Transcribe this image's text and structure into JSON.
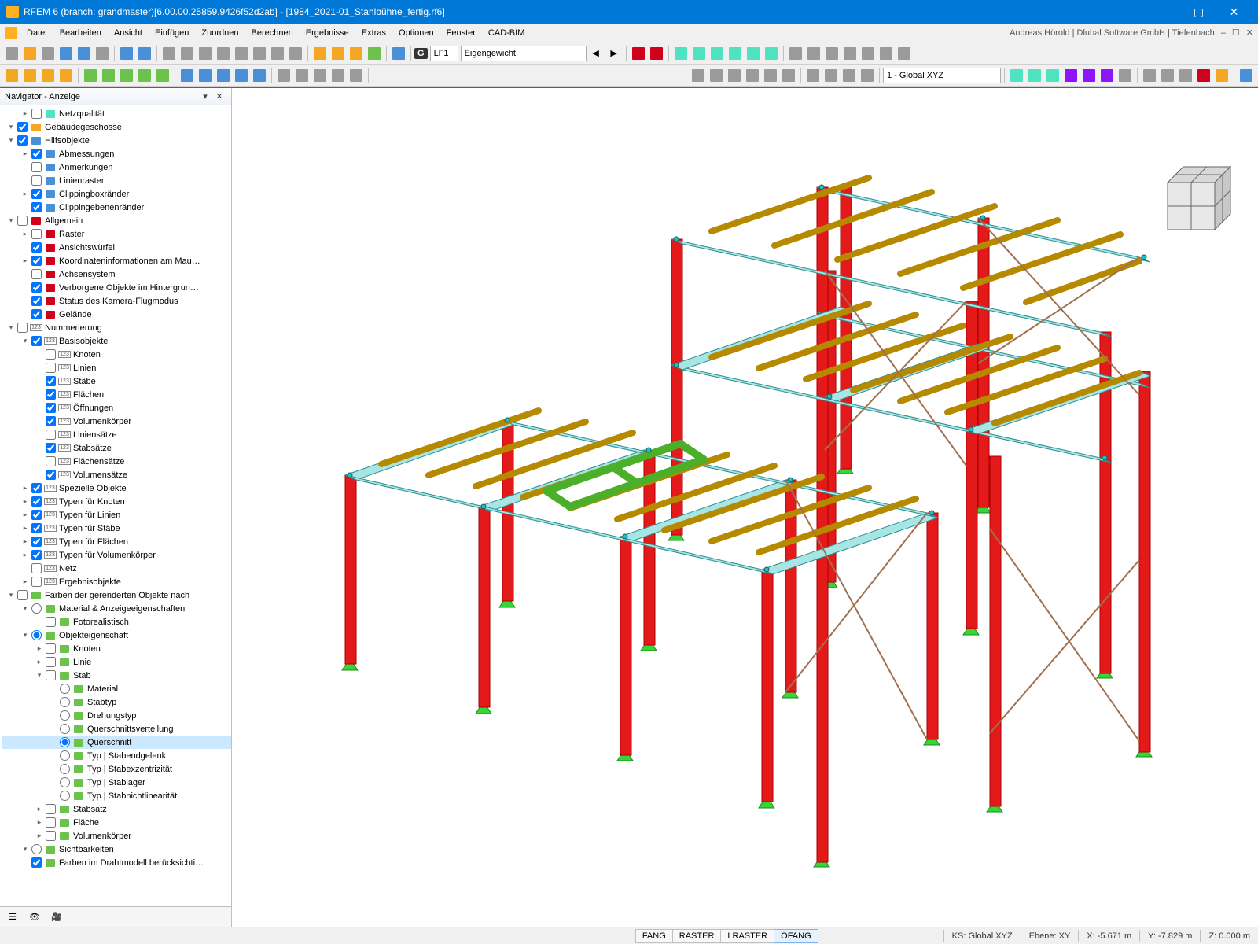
{
  "title": "RFEM 6 (branch: grandmaster)[6.00.00.25859.9426f52d2ab] - [1984_2021-01_Stahlbühne_fertig.rf6]",
  "menu": [
    "Datei",
    "Bearbeiten",
    "Ansicht",
    "Einfügen",
    "Zuordnen",
    "Berechnen",
    "Ergebnisse",
    "Extras",
    "Optionen",
    "Fenster",
    "CAD-BIM"
  ],
  "userline": "Andreas Hörold | Dlubal Software GmbH | Tiefenbach",
  "tb1": {
    "lf_badge": "G",
    "lf": "LF1",
    "lf_name": "Eigengewicht"
  },
  "tb2": {
    "coord": "1 - Global XYZ"
  },
  "nav": {
    "title": "Navigator - Anzeige"
  },
  "tree": [
    {
      "d": 1,
      "e": ">",
      "c": false,
      "ic": "i-cyan",
      "t": "Netzqualität"
    },
    {
      "d": 0,
      "e": "v",
      "c": true,
      "ic": "i-orange",
      "t": "Gebäudegeschosse"
    },
    {
      "d": 0,
      "e": "v",
      "c": true,
      "ic": "i-blue",
      "t": "Hilfsobjekte"
    },
    {
      "d": 1,
      "e": ">",
      "c": true,
      "ic": "i-blue",
      "t": "Abmessungen"
    },
    {
      "d": 1,
      "e": "",
      "c": false,
      "ic": "i-blue",
      "t": "Anmerkungen"
    },
    {
      "d": 1,
      "e": "",
      "c": false,
      "ic": "i-blue",
      "t": "Linienraster"
    },
    {
      "d": 1,
      "e": ">",
      "c": true,
      "ic": "i-blue",
      "t": "Clippingboxränder"
    },
    {
      "d": 1,
      "e": "",
      "c": true,
      "ic": "i-blue",
      "t": "Clippingebenenränder"
    },
    {
      "d": 0,
      "e": "v",
      "c": false,
      "ic": "i-red",
      "t": "Allgemein"
    },
    {
      "d": 1,
      "e": ">",
      "c": false,
      "ic": "i-red",
      "t": "Raster"
    },
    {
      "d": 1,
      "e": "",
      "c": true,
      "ic": "i-red",
      "t": "Ansichtswürfel"
    },
    {
      "d": 1,
      "e": ">",
      "c": true,
      "ic": "i-red",
      "t": "Koordinateninformationen am Mau…"
    },
    {
      "d": 1,
      "e": "",
      "c": false,
      "ic": "i-red",
      "t": "Achsensystem"
    },
    {
      "d": 1,
      "e": "",
      "c": true,
      "ic": "i-red",
      "t": "Verborgene Objekte im Hintergrun…"
    },
    {
      "d": 1,
      "e": "",
      "c": true,
      "ic": "i-red",
      "t": "Status des Kamera-Flugmodus"
    },
    {
      "d": 1,
      "e": "",
      "c": true,
      "ic": "i-red",
      "t": "Gelände"
    },
    {
      "d": 0,
      "e": "v",
      "c": false,
      "ic": "i-gray",
      "t": "Nummerierung",
      "badge": "123"
    },
    {
      "d": 1,
      "e": "v",
      "c": true,
      "ic": "i-gray",
      "t": "Basisobjekte",
      "badge": "123"
    },
    {
      "d": 2,
      "e": "",
      "c": false,
      "ic": "i-gray",
      "t": "Knoten",
      "badge": "123"
    },
    {
      "d": 2,
      "e": "",
      "c": false,
      "ic": "i-gray",
      "t": "Linien",
      "badge": "123"
    },
    {
      "d": 2,
      "e": "",
      "c": true,
      "ic": "i-gray",
      "t": "Stäbe",
      "badge": "123"
    },
    {
      "d": 2,
      "e": "",
      "c": true,
      "ic": "i-gray",
      "t": "Flächen",
      "badge": "123"
    },
    {
      "d": 2,
      "e": "",
      "c": true,
      "ic": "i-gray",
      "t": "Öffnungen",
      "badge": "123"
    },
    {
      "d": 2,
      "e": "",
      "c": true,
      "ic": "i-gray",
      "t": "Volumenkörper",
      "badge": "123"
    },
    {
      "d": 2,
      "e": "",
      "c": false,
      "ic": "i-gray",
      "t": "Liniensätze",
      "badge": "123"
    },
    {
      "d": 2,
      "e": "",
      "c": true,
      "ic": "i-gray",
      "t": "Stabsätze",
      "badge": "123"
    },
    {
      "d": 2,
      "e": "",
      "c": false,
      "ic": "i-gray",
      "t": "Flächensätze",
      "badge": "123"
    },
    {
      "d": 2,
      "e": "",
      "c": true,
      "ic": "i-gray",
      "t": "Volumensätze",
      "badge": "123"
    },
    {
      "d": 1,
      "e": ">",
      "c": true,
      "ic": "i-gray",
      "t": "Spezielle Objekte",
      "badge": "123"
    },
    {
      "d": 1,
      "e": ">",
      "c": true,
      "ic": "i-gray",
      "t": "Typen für Knoten",
      "badge": "123"
    },
    {
      "d": 1,
      "e": ">",
      "c": true,
      "ic": "i-gray",
      "t": "Typen für Linien",
      "badge": "123"
    },
    {
      "d": 1,
      "e": ">",
      "c": true,
      "ic": "i-gray",
      "t": "Typen für Stäbe",
      "badge": "123"
    },
    {
      "d": 1,
      "e": ">",
      "c": true,
      "ic": "i-gray",
      "t": "Typen für Flächen",
      "badge": "123"
    },
    {
      "d": 1,
      "e": ">",
      "c": true,
      "ic": "i-gray",
      "t": "Typen für Volumenkörper",
      "badge": "123"
    },
    {
      "d": 1,
      "e": "",
      "c": false,
      "ic": "i-gray",
      "t": "Netz",
      "badge": "123"
    },
    {
      "d": 1,
      "e": ">",
      "c": false,
      "ic": "i-gray",
      "t": "Ergebnisobjekte",
      "badge": "123"
    },
    {
      "d": 0,
      "e": "v",
      "c": false,
      "ic": "i-green",
      "t": "Farben der gerenderten Objekte nach"
    },
    {
      "d": 1,
      "e": "v",
      "r": true,
      "rs": false,
      "ic": "i-green",
      "t": "Material & Anzeigeeigenschaften"
    },
    {
      "d": 2,
      "e": "",
      "c": false,
      "ic": "i-green",
      "t": "Fotorealistisch"
    },
    {
      "d": 1,
      "e": "v",
      "r": true,
      "rs": true,
      "ic": "i-green",
      "t": "Objekteigenschaft"
    },
    {
      "d": 2,
      "e": ">",
      "c": false,
      "ic": "i-green",
      "t": "Knoten"
    },
    {
      "d": 2,
      "e": ">",
      "c": false,
      "ic": "i-green",
      "t": "Linie"
    },
    {
      "d": 2,
      "e": "v",
      "c": false,
      "ic": "i-green",
      "t": "Stab"
    },
    {
      "d": 3,
      "e": "",
      "r": true,
      "rs": false,
      "ic": "i-green",
      "t": "Material"
    },
    {
      "d": 3,
      "e": "",
      "r": true,
      "rs": false,
      "ic": "i-green",
      "t": "Stabtyp"
    },
    {
      "d": 3,
      "e": "",
      "r": true,
      "rs": false,
      "ic": "i-green",
      "t": "Drehungstyp"
    },
    {
      "d": 3,
      "e": "",
      "r": true,
      "rs": false,
      "ic": "i-green",
      "t": "Querschnittsverteilung"
    },
    {
      "d": 3,
      "e": "",
      "r": true,
      "rs": true,
      "ic": "i-green",
      "t": "Querschnitt",
      "sel": true
    },
    {
      "d": 3,
      "e": "",
      "r": true,
      "rs": false,
      "ic": "i-green",
      "t": "Typ | Stabendgelenk"
    },
    {
      "d": 3,
      "e": "",
      "r": true,
      "rs": false,
      "ic": "i-green",
      "t": "Typ | Stabexzentrizität"
    },
    {
      "d": 3,
      "e": "",
      "r": true,
      "rs": false,
      "ic": "i-green",
      "t": "Typ | Stablager"
    },
    {
      "d": 3,
      "e": "",
      "r": true,
      "rs": false,
      "ic": "i-green",
      "t": "Typ | Stabnichtlinearität"
    },
    {
      "d": 2,
      "e": ">",
      "c": false,
      "ic": "i-green",
      "t": "Stabsatz"
    },
    {
      "d": 2,
      "e": ">",
      "c": false,
      "ic": "i-green",
      "t": "Fläche"
    },
    {
      "d": 2,
      "e": ">",
      "c": false,
      "ic": "i-green",
      "t": "Volumenkörper"
    },
    {
      "d": 1,
      "e": "v",
      "r": true,
      "rs": false,
      "ic": "i-green",
      "t": "Sichtbarkeiten"
    },
    {
      "d": 1,
      "e": "",
      "c": true,
      "ic": "i-green",
      "t": "Farben im Drahtmodell berücksichti…"
    }
  ],
  "status": {
    "toggles": [
      "FANG",
      "RASTER",
      "LRASTER",
      "OFANG"
    ],
    "active": "OFANG",
    "ks": "KS: Global XYZ",
    "ebene": "Ebene:  XY",
    "x": "X: -5.671 m",
    "y": "Y: -7.829 m",
    "z": "Z: 0.000 m"
  }
}
